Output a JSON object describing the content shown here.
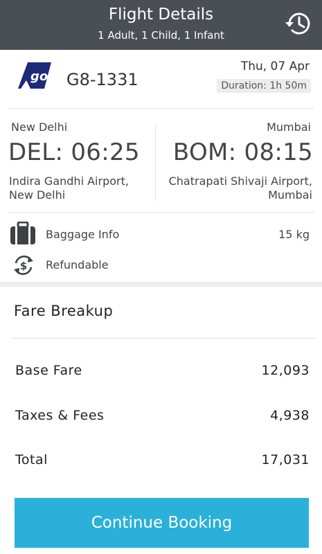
{
  "header": {
    "title": "Flight Details",
    "subtitle": "1 Adult, 1 Child, 1 Infant",
    "history_icon": "history-clock-icon"
  },
  "flight": {
    "airline_logo": "go-airline-logo",
    "flight_number": "G8-1331",
    "date": "Thu, 07 Apr",
    "duration": "Duration: 1h 50m"
  },
  "departure": {
    "city": "New Delhi",
    "code_time": "DEL: 06:25",
    "airport_line1": "Indira Gandhi Airport,",
    "airport_line2": "New Delhi"
  },
  "arrival": {
    "city": "Mumbai",
    "code_time": "BOM: 08:15",
    "airport_line1": "Chatrapati Shivaji Airport,",
    "airport_line2": "Mumbai"
  },
  "info": {
    "baggage_icon": "suitcase-icon",
    "baggage_label": "Baggage Info",
    "baggage_value": "15 kg",
    "refund_icon": "refund-cycle-icon",
    "refund_label": "Refundable"
  },
  "fare": {
    "title": "Fare Breakup",
    "rows": [
      {
        "label": "Base Fare",
        "value": "12,093"
      },
      {
        "label": "Taxes & Fees",
        "value": "4,938"
      },
      {
        "label": "Total",
        "value": "17,031"
      }
    ]
  },
  "cta": {
    "label": "Continue Booking"
  },
  "colors": {
    "header_bg": "#4a4f55",
    "accent": "#2bb0d9",
    "logo_blue": "#1d2a7a"
  }
}
